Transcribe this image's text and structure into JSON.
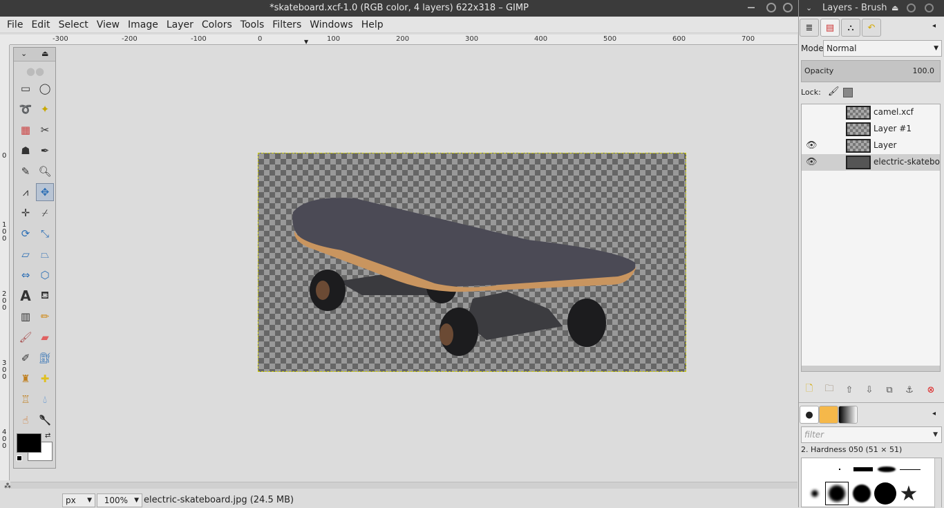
{
  "window": {
    "title": "*skateboard.xcf-1.0 (RGB color, 4 layers) 622x318 – GIMP"
  },
  "menu": [
    "File",
    "Edit",
    "Select",
    "View",
    "Image",
    "Layer",
    "Colors",
    "Tools",
    "Filters",
    "Windows",
    "Help"
  ],
  "ruler": {
    "top_labels": [
      "-300",
      "-200",
      "-100",
      "0",
      "100",
      "200",
      "300",
      "400",
      "500",
      "600",
      "700"
    ],
    "left_labels": [
      "0",
      "1\n0\n0",
      "2\n0\n0",
      "3\n0\n0",
      "4\n0\n0"
    ]
  },
  "status": {
    "unit": "px",
    "zoom": "100%",
    "info": "electric-skateboard.jpg (24.5 MB)"
  },
  "dock": {
    "title": "Layers - Brush",
    "mode_label": "Mode:",
    "mode_value": "Normal",
    "opacity_label": "Opacity",
    "opacity_value": "100.0",
    "lock_label": "Lock:",
    "layers": [
      {
        "name": "camel.xcf",
        "visible": false,
        "selected": false
      },
      {
        "name": "Layer #1",
        "visible": false,
        "selected": false
      },
      {
        "name": "Layer",
        "visible": true,
        "selected": false
      },
      {
        "name": "electric-skateboard.jpg",
        "visible": true,
        "selected": true
      }
    ],
    "filter_placeholder": "filter",
    "brush_name": "2. Hardness 050 (51 × 51)"
  },
  "colors": {
    "foreground": "#000000",
    "background": "#ffffff",
    "selection": "#c9c900"
  }
}
